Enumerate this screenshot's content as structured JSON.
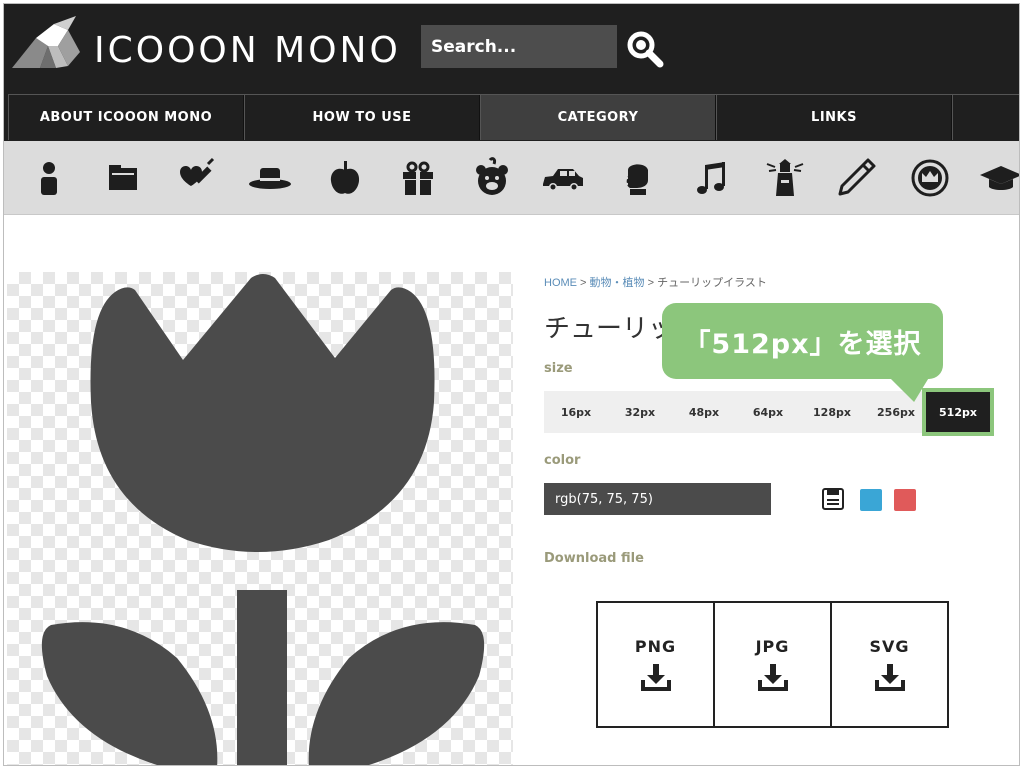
{
  "header": {
    "brand": "ICOOON MONO",
    "search": {
      "value": "Search..."
    },
    "nav": [
      {
        "label": "ABOUT ICOOON MONO",
        "active": false
      },
      {
        "label": "HOW TO USE",
        "active": false
      },
      {
        "label": "CATEGORY",
        "active": true
      },
      {
        "label": "LINKS",
        "active": false
      }
    ]
  },
  "categories": [
    {
      "icon": "person-icon"
    },
    {
      "icon": "folder-icon"
    },
    {
      "icon": "health-heart-syringe-icon"
    },
    {
      "icon": "hat-icon"
    },
    {
      "icon": "apple-icon"
    },
    {
      "icon": "gift-icon"
    },
    {
      "icon": "bear-icon"
    },
    {
      "icon": "car-icon"
    },
    {
      "icon": "boxing-glove-icon"
    },
    {
      "icon": "music-note-icon"
    },
    {
      "icon": "lighthouse-icon"
    },
    {
      "icon": "pencil-icon"
    },
    {
      "icon": "crown-badge-icon"
    },
    {
      "icon": "graduation-cap-icon"
    }
  ],
  "preview": {
    "icon": "tulip-icon",
    "color": "#4b4b4b"
  },
  "breadcrumb": {
    "home": "HOME",
    "sep1": " > ",
    "category": "動物・植物",
    "sep2": " > ",
    "current": "チューリップイラスト"
  },
  "title": "チューリップイラスト",
  "size": {
    "label": "size",
    "options": [
      "16px",
      "32px",
      "48px",
      "64px",
      "128px",
      "256px",
      "512px"
    ],
    "selected": "512px"
  },
  "color": {
    "label": "color",
    "value": "rgb(75, 75, 75)",
    "swatches": [
      "#3aa6d6",
      "#e05a5a"
    ]
  },
  "download": {
    "label": "Download file",
    "formats": [
      "PNG",
      "JPG",
      "SVG"
    ]
  },
  "callout": {
    "text": "「512px」を選択",
    "color": "#8cc67c"
  }
}
